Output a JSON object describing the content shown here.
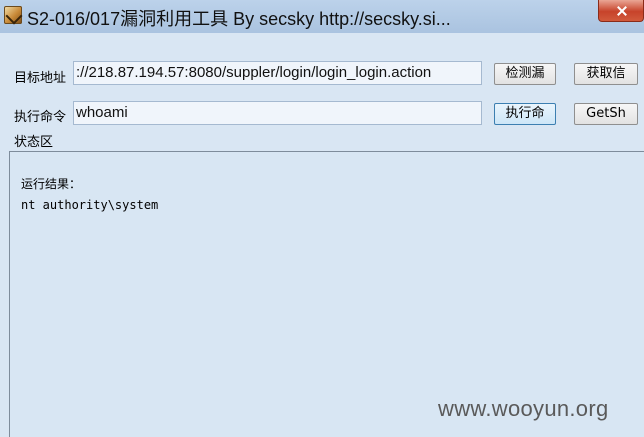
{
  "window": {
    "title": "S2-016/017漏洞利用工具  By secsky      http://secsky.si..."
  },
  "form": {
    "url_label": "目标地址",
    "url_value": "://218.87.194.57:8080/suppler/login/login_login.action",
    "detect_button": "检测漏",
    "get_info_button": "获取信",
    "cmd_label": "执行命令",
    "cmd_value": "whoami",
    "exec_button": "执行命",
    "getshell_button": "GetSh"
  },
  "status": {
    "group_label": "状态区",
    "lines": [
      "运行结果：",
      "nt authority\\system"
    ]
  },
  "watermark": "www.wooyun.org",
  "colors": {
    "window_bg": "#d9e6f3",
    "title_bg": "#bcd2ea",
    "close_red": "#c7432a",
    "focus_border": "#3c7fb1"
  }
}
